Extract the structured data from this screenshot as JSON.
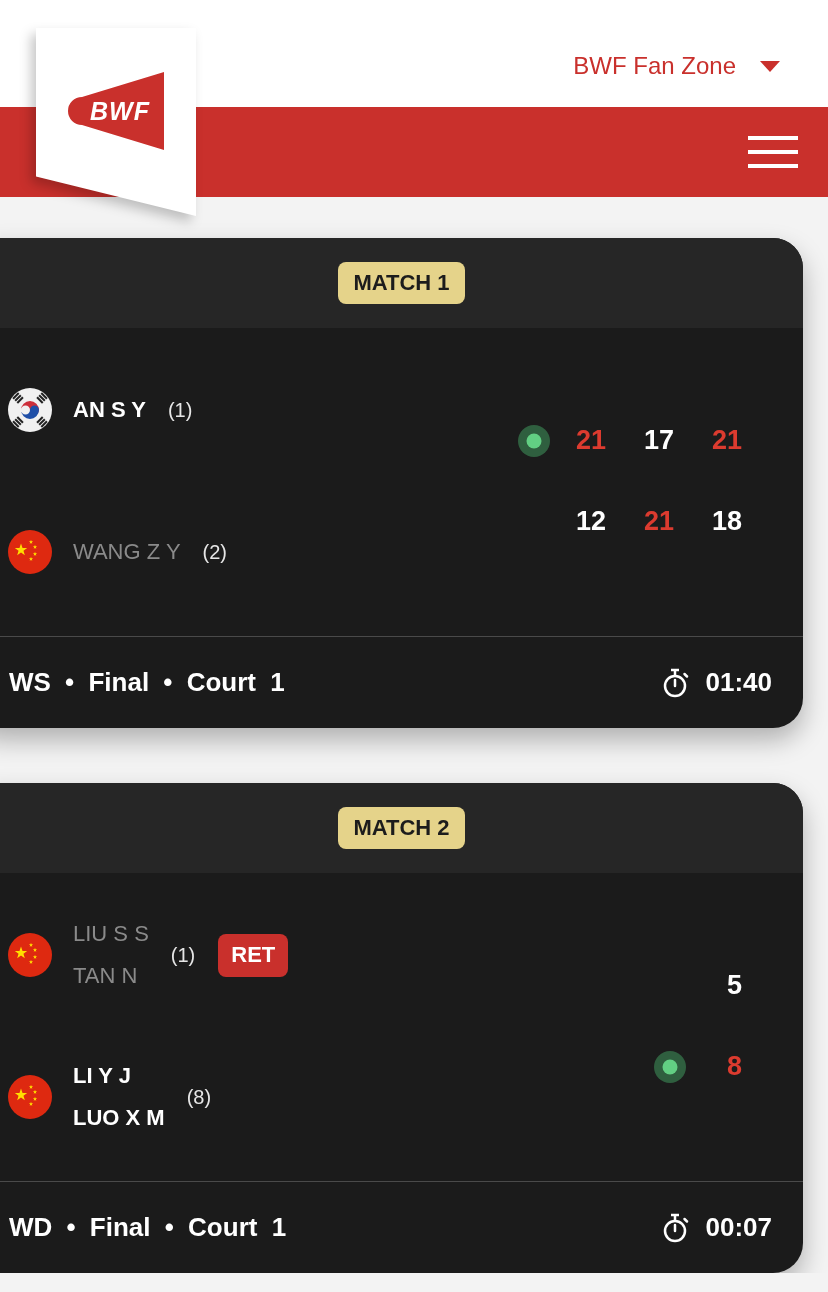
{
  "header": {
    "logo_text": "BWF",
    "menu_label": "BWF Fan Zone"
  },
  "matches": [
    {
      "label": "MATCH 1",
      "sides": [
        {
          "kind": "korea",
          "players": [
            "AN S Y"
          ],
          "seed": "(1)",
          "winner": true,
          "serving": true,
          "games": [
            {
              "score": "21",
              "won": true
            },
            {
              "score": "17",
              "won": false
            },
            {
              "score": "21",
              "won": true
            }
          ]
        },
        {
          "kind": "china",
          "players": [
            "WANG Z Y"
          ],
          "seed": "(2)",
          "winner": false,
          "serving": false,
          "games": [
            {
              "score": "12",
              "won": false
            },
            {
              "score": "21",
              "won": true
            },
            {
              "score": "18",
              "won": false
            }
          ]
        }
      ],
      "info": "WS • Final • Court 1",
      "duration": "01:40"
    },
    {
      "label": "MATCH 2",
      "sides": [
        {
          "kind": "china",
          "players": [
            "LIU S S",
            "TAN N"
          ],
          "seed": "(1)",
          "badge": "RET",
          "winner": false,
          "serving": false,
          "games": [
            {
              "score": "5",
              "won": false
            }
          ]
        },
        {
          "kind": "china",
          "players": [
            "LI Y J",
            "LUO X M"
          ],
          "seed": "(8)",
          "winner": true,
          "serving": true,
          "games": [
            {
              "score": "8",
              "won": true
            }
          ]
        }
      ],
      "info": "WD • Final • Court 1",
      "duration": "00:07"
    }
  ]
}
